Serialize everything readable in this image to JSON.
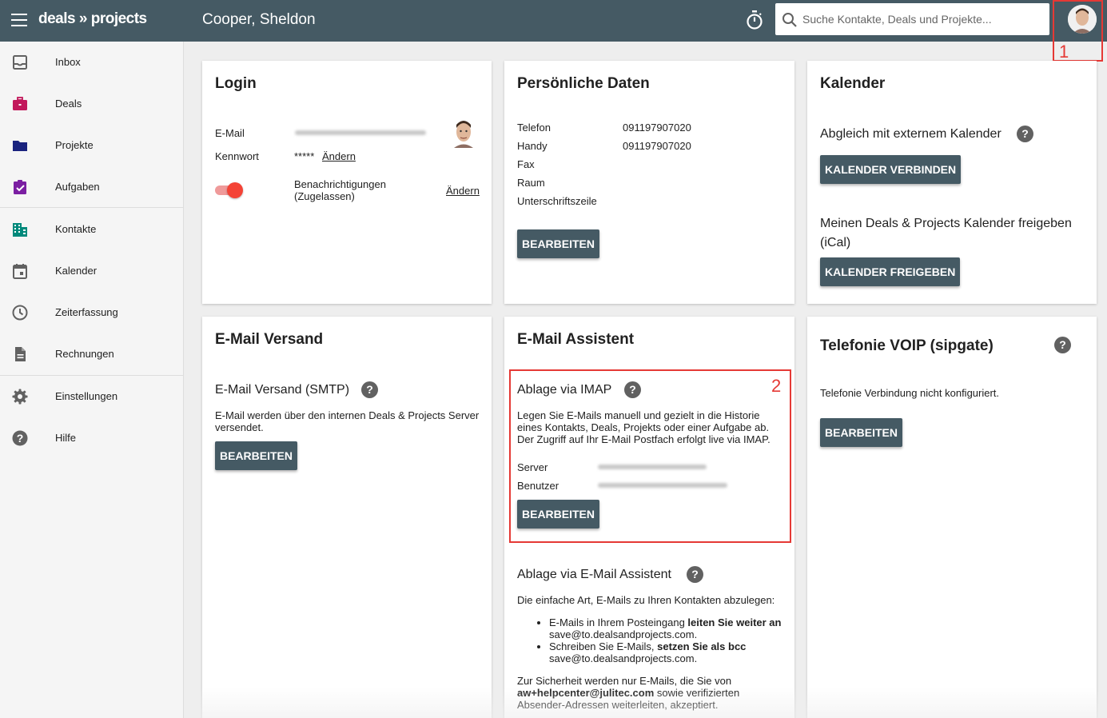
{
  "topbar": {
    "logo": "deals » projects",
    "user_name": "Cooper, Sheldon",
    "search_placeholder": "Suche Kontakte, Deals und Projekte..."
  },
  "annotations": {
    "one": "1",
    "two": "2"
  },
  "colors": {
    "topbar": "#455a64",
    "button": "#455a64",
    "annotation": "#e53935",
    "toggle": "#f44336",
    "deals_icon": "#c2185b",
    "projekte_icon": "#1a237e",
    "aufgaben_icon": "#7b1fa2",
    "kontakte_icon": "#00897b"
  },
  "sidebar": {
    "items": [
      {
        "label": "Inbox",
        "icon": "inbox-icon"
      },
      {
        "label": "Deals",
        "icon": "briefcase-icon"
      },
      {
        "label": "Projekte",
        "icon": "folder-icon"
      },
      {
        "label": "Aufgaben",
        "icon": "clipboard-check-icon"
      },
      {
        "label": "Kontakte",
        "icon": "building-icon"
      },
      {
        "label": "Kalender",
        "icon": "calendar-icon"
      },
      {
        "label": "Zeiterfassung",
        "icon": "clock-icon"
      },
      {
        "label": "Rechnungen",
        "icon": "document-icon"
      },
      {
        "label": "Einstellungen",
        "icon": "gear-icon"
      },
      {
        "label": "Hilfe",
        "icon": "help-icon"
      }
    ]
  },
  "login": {
    "title": "Login",
    "email_label": "E-Mail",
    "password_label": "Kennwort",
    "password_value": "*****",
    "change_link": "Ändern",
    "notifications_label_1": "Benachrichtigungen",
    "notifications_label_2": "(Zugelassen)",
    "notifications_change": "Ändern",
    "notifications_enabled": true
  },
  "personal": {
    "title": "Persönliche Daten",
    "rows": [
      {
        "label": "Telefon",
        "value": "091197907020"
      },
      {
        "label": "Handy",
        "value": "091197907020"
      },
      {
        "label": "Fax",
        "value": ""
      },
      {
        "label": "Raum",
        "value": ""
      },
      {
        "label": "Unterschriftszeile",
        "value": ""
      }
    ],
    "edit_button": "BEARBEITEN"
  },
  "calendar": {
    "title": "Kalender",
    "sync_label": "Abgleich mit externem Kalender",
    "connect_button": "KALENDER VERBINDEN",
    "share_label_1": "Meinen Deals & Projects Kalender freigeben",
    "share_label_2": "(iCal)",
    "share_button": "KALENDER FREIGEBEN"
  },
  "email_send": {
    "title": "E-Mail Versand",
    "subtitle": "E-Mail Versand (SMTP)",
    "text_1": "E-Mail werden über den internen Deals & Projects Server",
    "text_2": "versendet.",
    "edit_button": "BEARBEITEN"
  },
  "email_assistant": {
    "title": "E-Mail Assistent",
    "imap_title": "Ablage via IMAP",
    "imap_text_1": "Legen Sie E-Mails manuell und gezielt in die Historie",
    "imap_text_2": "eines Kontakts, Deals, Projekts oder einer Aufgabe ab.",
    "imap_text_3": "Der Zugriff auf Ihr E-Mail Postfach erfolgt live via IMAP.",
    "server_label": "Server",
    "user_label": "Benutzer",
    "edit_button": "BEARBEITEN",
    "assist_title": "Ablage via E-Mail Assistent",
    "assist_intro": "Die einfache Art, E-Mails zu Ihren Kontakten abzulegen:",
    "bullet_1_a": "E-Mails in Ihrem Posteingang ",
    "bullet_1_b": "leiten Sie weiter an",
    "bullet_1_c": "save@to.dealsandprojects.com.",
    "bullet_2_a": "Schreiben Sie E-Mails, ",
    "bullet_2_b": "setzen Sie als bcc",
    "bullet_2_c": "save@to.dealsandprojects.com.",
    "security_1": "Zur Sicherheit werden nur E-Mails, die Sie von",
    "security_2a": "aw+helpcenter@julitec.com",
    "security_2b": " sowie verifizierten",
    "security_3": "Absender-Adressen weiterleiten, akzeptiert."
  },
  "voip": {
    "title": "Telefonie VOIP (sipgate)",
    "status": "Telefonie Verbindung nicht konfiguriert.",
    "edit_button": "BEARBEITEN"
  }
}
